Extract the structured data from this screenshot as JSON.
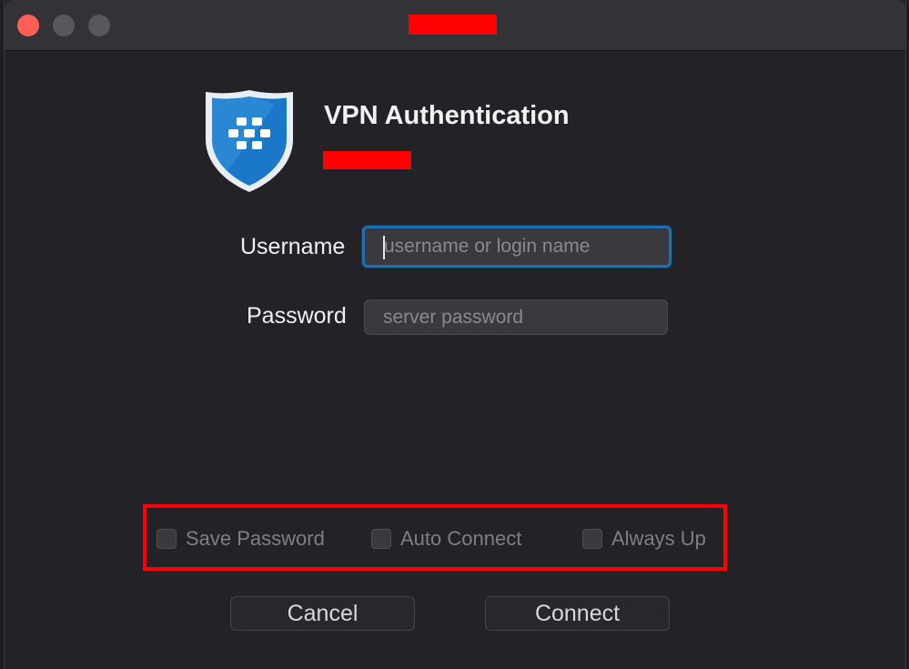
{
  "window": {
    "title_redacted": true
  },
  "app": {
    "title": "VPN Authentication",
    "subtitle_redacted": true,
    "logo_icon": "shield-logo-icon"
  },
  "form": {
    "username_label": "Username",
    "username_placeholder": "username or login name",
    "username_value": "",
    "password_label": "Password",
    "password_placeholder": "server password",
    "password_value": ""
  },
  "options": {
    "save_password": {
      "label": "Save Password",
      "checked": false
    },
    "auto_connect": {
      "label": "Auto Connect",
      "checked": false
    },
    "always_up": {
      "label": "Always Up",
      "checked": false
    }
  },
  "buttons": {
    "cancel": "Cancel",
    "connect": "Connect"
  },
  "colors": {
    "redaction": "#ff0000",
    "focus_ring": "#1f6fb0",
    "close_light": "#ff5f57"
  }
}
